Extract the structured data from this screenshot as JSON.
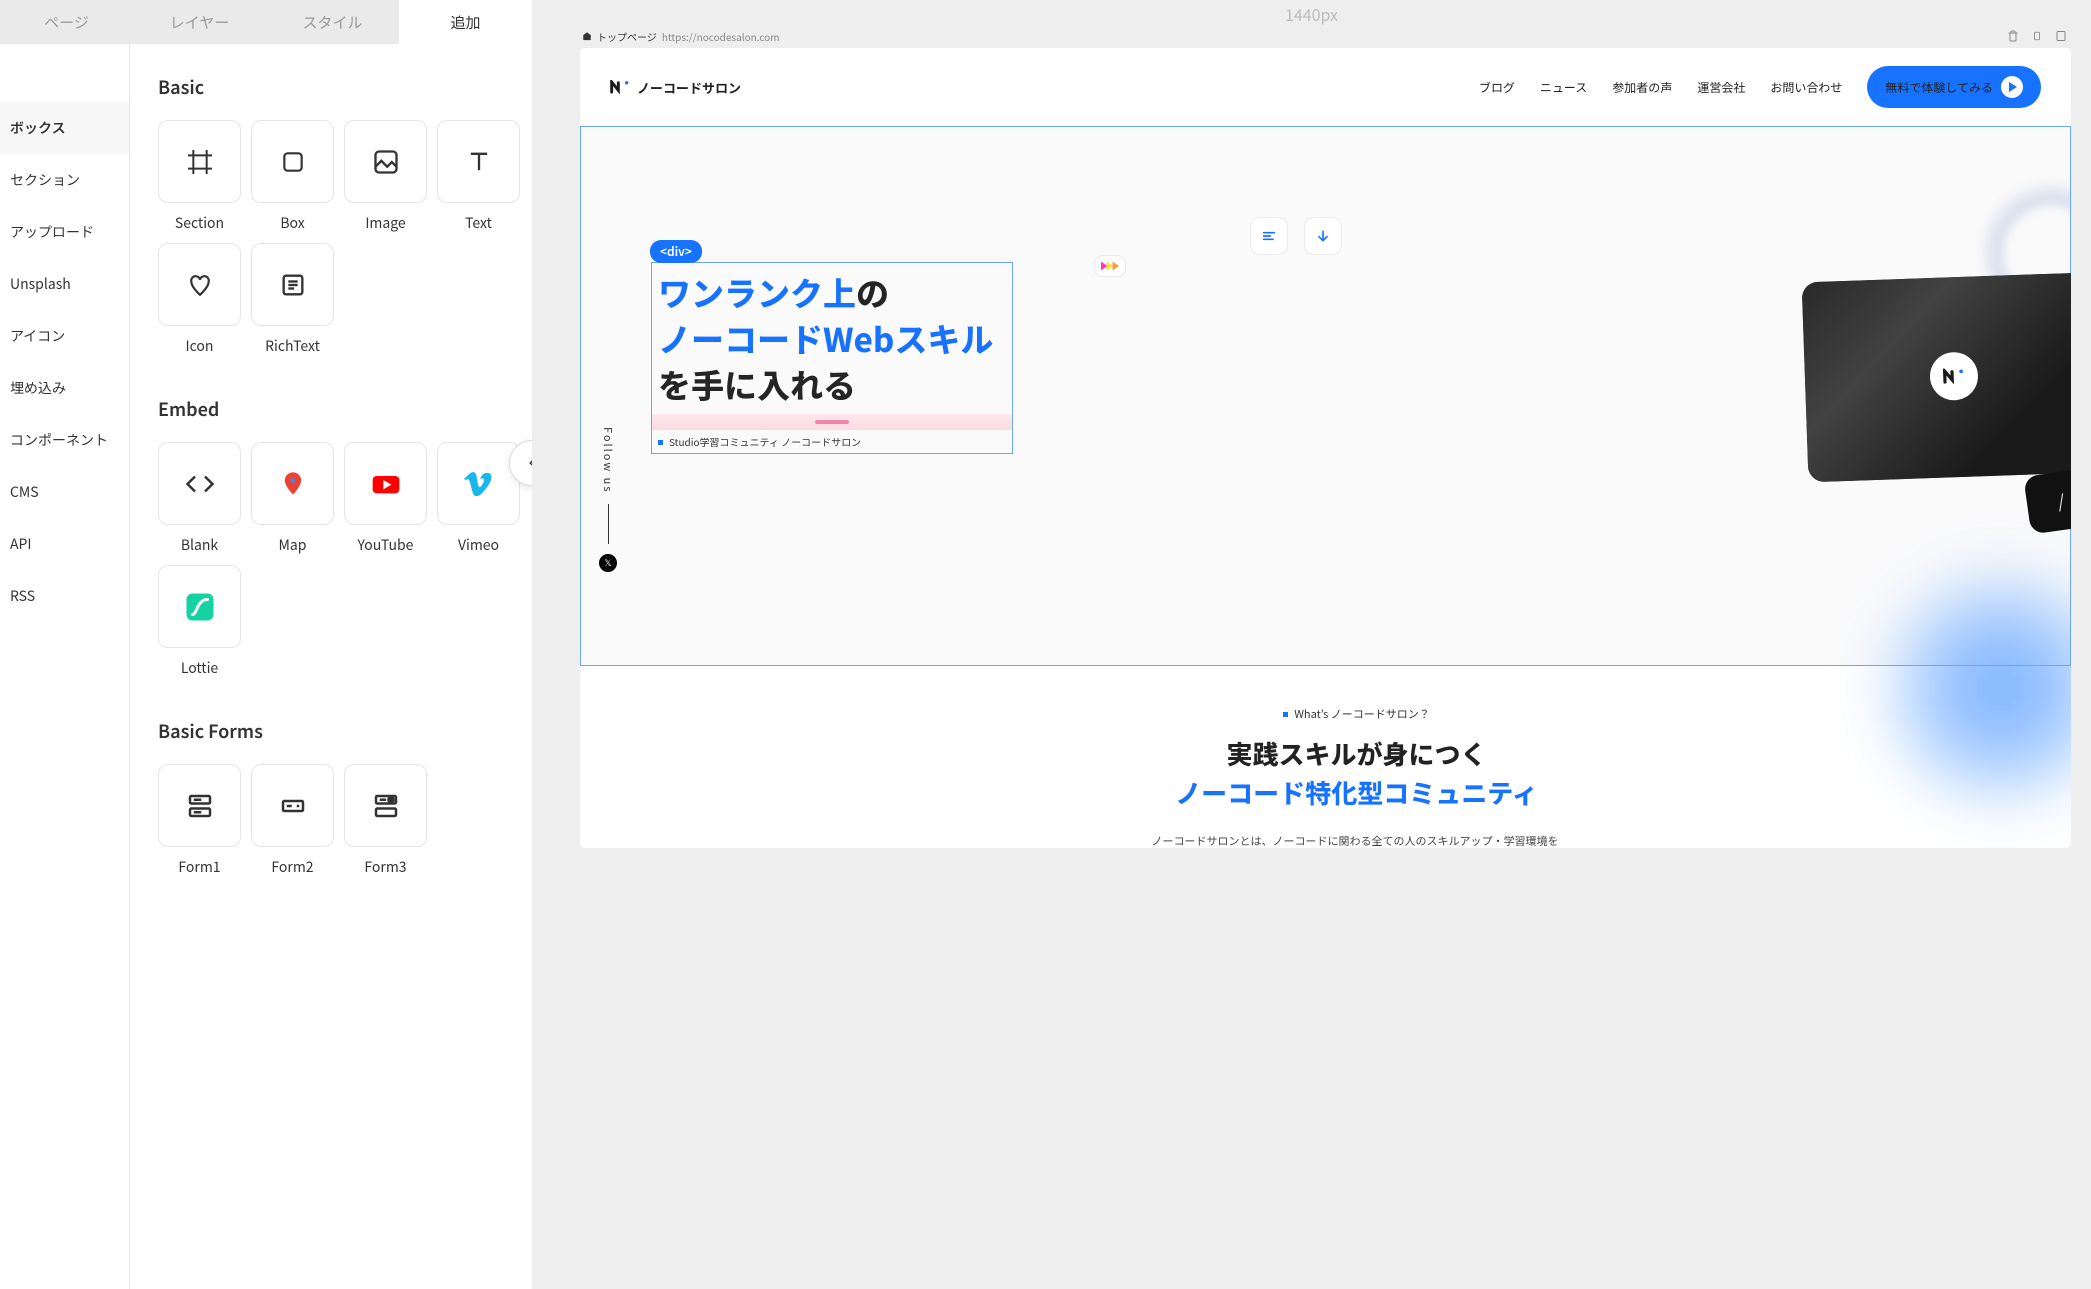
{
  "tabs": {
    "page": "ページ",
    "layer": "レイヤー",
    "style": "スタイル",
    "add": "追加"
  },
  "categories": {
    "box": "ボックス",
    "section": "セクション",
    "upload": "アップロード",
    "unsplash": "Unsplash",
    "icon": "アイコン",
    "embed": "埋め込み",
    "component": "コンポーネント",
    "cms": "CMS",
    "api": "API",
    "rss": "RSS"
  },
  "sections": {
    "basic": "Basic",
    "embed": "Embed",
    "basic_forms": "Basic Forms"
  },
  "blocks": {
    "section": "Section",
    "box": "Box",
    "image": "Image",
    "text": "Text",
    "icon": "Icon",
    "richtext": "RichText",
    "blank": "Blank",
    "map": "Map",
    "youtube": "YouTube",
    "vimeo": "Vimeo",
    "lottie": "Lottie",
    "form1": "Form1",
    "form2": "Form2",
    "form3": "Form3"
  },
  "canvas": {
    "size_label": "1440px",
    "frame": {
      "page_name": "トップページ",
      "page_url": "https://nocodesalon.com"
    },
    "element_tag": "<div>",
    "site": {
      "logo_text": "ノーコードサロン",
      "nav": {
        "blog": "ブログ",
        "news": "ニュース",
        "voice": "参加者の声",
        "company": "運営会社",
        "contact": "お問い合わせ",
        "cta": "無料で体験してみる"
      },
      "follow_us": "Follow us",
      "hero": {
        "t1": "ワンランク上",
        "t2": "の",
        "t3": "ノーコードWebスキル",
        "t4": "を手に入れる",
        "sub": "Studio学習コミュニティ ノーコードサロン"
      },
      "slash_key": "/",
      "bottom": {
        "badge": "What’s ノーコードサロン？",
        "title1": "実践スキルが身につく",
        "title2": "ノーコード特化型コミュニティ",
        "para": "ノーコードサロンとは、ノーコードに関わる全ての人のスキルアップ・学習環境を作るべく活動しているオンラインコミュニティです。多種多様なメンバーの特性を活かしたイベントの開催や交流会、技術相談などを行い、業界全体の発展に寄与します。"
      }
    }
  }
}
